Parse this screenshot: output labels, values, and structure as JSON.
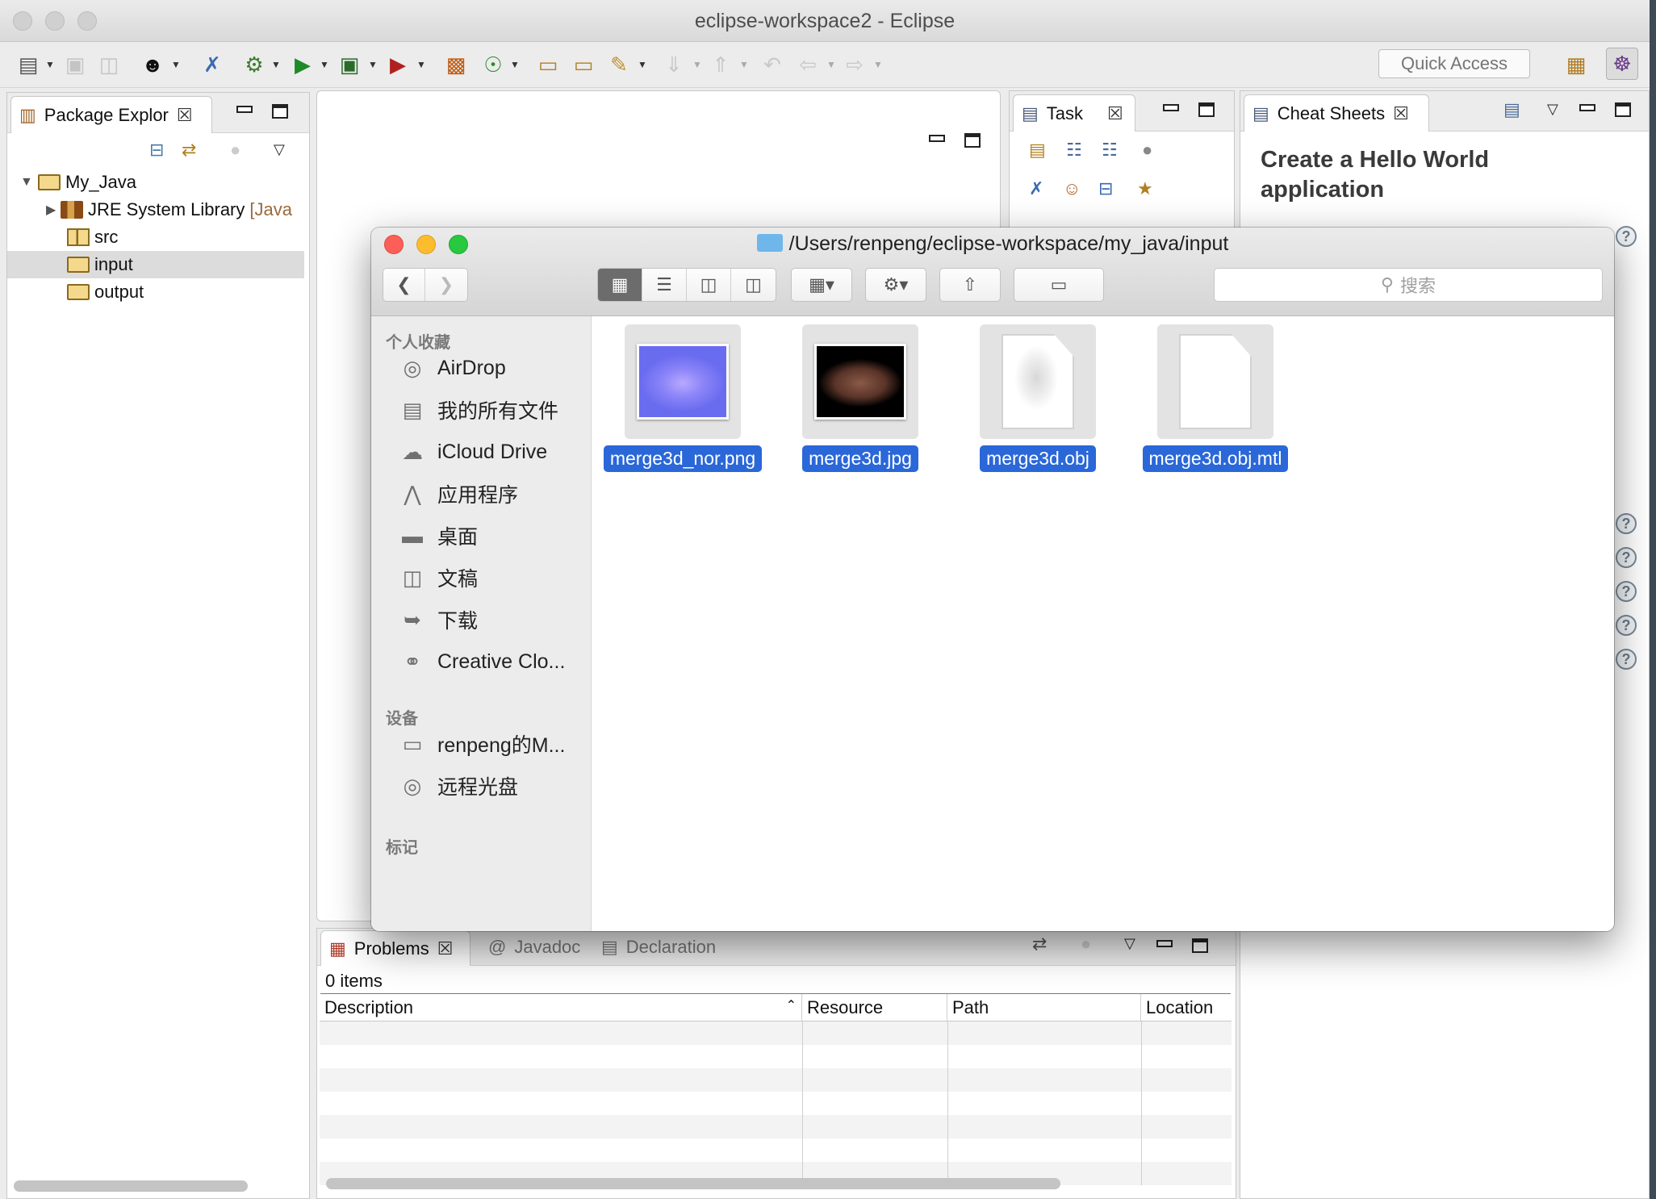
{
  "window": {
    "title": "eclipse-workspace2 - Eclipse"
  },
  "toolbar": {
    "quick_access_placeholder": "Quick Access",
    "icons": [
      "new-wizard-icon",
      "save-icon",
      "save-all-icon",
      "profile-icon",
      "skip-breakpoints-icon",
      "debug-icon",
      "run-icon",
      "coverage-icon",
      "external-tools-icon",
      "new-java-project-icon",
      "new-class-icon",
      "open-type-icon",
      "open-task-icon",
      "search-icon",
      "next-annotation-icon",
      "prev-annotation-icon",
      "last-edit-icon",
      "back-icon",
      "forward-icon",
      "open-perspective-icon",
      "java-perspective-icon"
    ]
  },
  "package_explorer": {
    "tab_label": "Package Explor",
    "tree": [
      {
        "label": "My_Java",
        "level": 0,
        "expanded": true
      },
      {
        "label": "JRE System Library",
        "suffix": "[Java",
        "level": 1,
        "expanded": false
      },
      {
        "label": "src",
        "level": 1
      },
      {
        "label": "input",
        "level": 1,
        "selected": true
      },
      {
        "label": "output",
        "level": 1
      }
    ]
  },
  "task_panel": {
    "tab_label": "Task"
  },
  "cheat_sheets": {
    "tab_label": "Cheat Sheets",
    "title_line1": "Create a Hello World",
    "title_line2": "application"
  },
  "problems": {
    "tabs": [
      "Problems",
      "Javadoc",
      "Declaration"
    ],
    "count_text": "0 items",
    "columns": [
      "Description",
      "Resource",
      "Path",
      "Location"
    ]
  },
  "finder": {
    "path": "/Users/renpeng/eclipse-workspace/my_java/input",
    "search_placeholder": "搜索",
    "favorites_heading": "个人收藏",
    "favorites": [
      {
        "label": "AirDrop",
        "icon": "airdrop-icon"
      },
      {
        "label": "我的所有文件",
        "icon": "all-files-icon"
      },
      {
        "label": "iCloud Drive",
        "icon": "icloud-icon"
      },
      {
        "label": "应用程序",
        "icon": "applications-icon"
      },
      {
        "label": "桌面",
        "icon": "desktop-icon"
      },
      {
        "label": "文稿",
        "icon": "documents-icon"
      },
      {
        "label": "下载",
        "icon": "downloads-icon"
      },
      {
        "label": "Creative Clo...",
        "icon": "creative-cloud-icon"
      }
    ],
    "devices_heading": "设备",
    "devices": [
      {
        "label": "renpeng的M...",
        "icon": "laptop-icon"
      },
      {
        "label": "远程光盘",
        "icon": "remote-disc-icon"
      }
    ],
    "tags_heading": "标记",
    "files": [
      {
        "name": "merge3d_nor.png",
        "kind": "normal-map-thumbnail"
      },
      {
        "name": "merge3d.jpg",
        "kind": "face-texture-thumbnail"
      },
      {
        "name": "merge3d.obj",
        "kind": "obj-model-thumbnail"
      },
      {
        "name": "merge3d.obj.mtl",
        "kind": "blank-document-icon"
      }
    ]
  },
  "colors": {
    "selection_blue": "#2a67d8",
    "finder_sidebar": "#ececec",
    "eclipse_chrome": "#ececec"
  }
}
